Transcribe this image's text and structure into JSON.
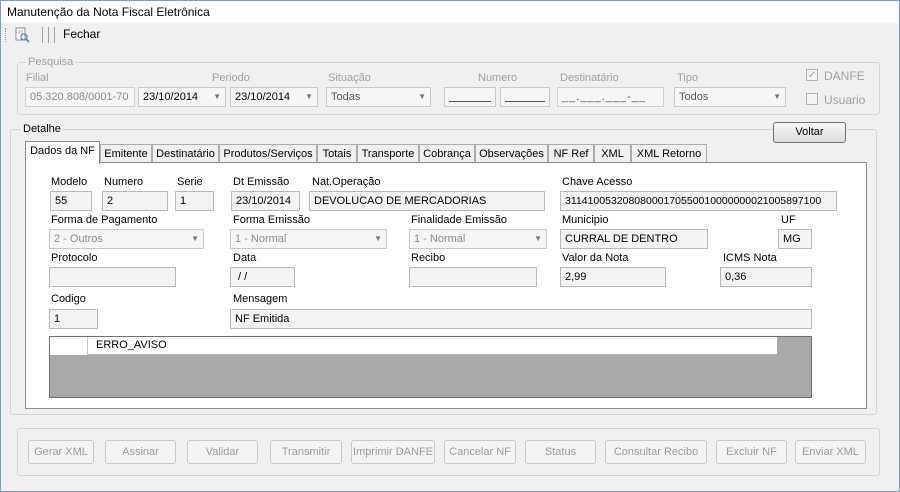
{
  "window": {
    "title": "Manutenção da Nota Fiscal Eletrônica"
  },
  "toolbar": {
    "close_label": "Fechar",
    "preview_icon": "print-preview-icon"
  },
  "pesquisa": {
    "group_label": "Pesquisa",
    "filial_label": "Filial",
    "filial_value": "05.320.808/0001-70",
    "periodo_label": "Periodo",
    "periodo_start": "23/10/2014",
    "periodo_end": "23/10/2014",
    "situacao_label": "Situação",
    "situacao_value": "Todas",
    "numero_label": "Numero",
    "numero_from": "",
    "numero_to": "",
    "destinatario_label": "Destinatário",
    "destinatario_mask": "__.___.___-__",
    "tipo_label": "Tipo",
    "tipo_value": "Todos",
    "danfe_label": "DANFE",
    "usuario_label": "Usuario"
  },
  "detalhe": {
    "group_label": "Detalhe",
    "voltar_label": "Voltar",
    "tabs": [
      "Dados da NF",
      "Emitente",
      "Destinatário",
      "Produtos/Serviços",
      "Totais",
      "Transporte",
      "Cobrança",
      "Observações",
      "NF Ref",
      "XML",
      "XML Retorno"
    ]
  },
  "nf": {
    "modelo_label": "Modelo",
    "modelo": "55",
    "numero_label": "Numero",
    "numero": "2",
    "serie_label": "Serie",
    "serie": "1",
    "dt_emissao_label": "Dt Emissão",
    "dt_emissao": "23/10/2014",
    "nat_operacao_label": "Nat.Operação",
    "nat_operacao": "DEVOLUCAO DE MERCADORIAS",
    "chave_label": "Chave Acesso",
    "chave": "31141005320808000170550010000000021005897100",
    "forma_pagamento_label": "Forma de Pagamento",
    "forma_pagamento": "2 - Outros",
    "forma_emissao_label": "Forma Emissão",
    "forma_emissao": "1 - Normal",
    "finalidade_label": "Finalidade Emissão",
    "finalidade": "1 - Normal",
    "municipio_label": "Municipio",
    "municipio": "CURRAL DE DENTRO",
    "uf_label": "UF",
    "uf": "MG",
    "protocolo_label": "Protocolo",
    "protocolo": "",
    "data_label": "Data",
    "data": " / /",
    "recibo_label": "Recibo",
    "recibo": "",
    "valor_label": "Valor da Nota",
    "valor": "2,99",
    "icms_label": "ICMS Nota",
    "icms": "0,36",
    "codigo_label": "Codigo",
    "codigo": "1",
    "mensagem_label": "Mensagem",
    "mensagem": "NF Emitida"
  },
  "grid": {
    "columns": [
      "ERRO_AVISO"
    ]
  },
  "actions": [
    "Gerar XML",
    "Assinar",
    "Validar",
    "Transmitir",
    "Imprimir DANFE",
    "Cancelar NF",
    "Status",
    "Consultar Recibo",
    "Excluir NF",
    "Enviar XML"
  ]
}
